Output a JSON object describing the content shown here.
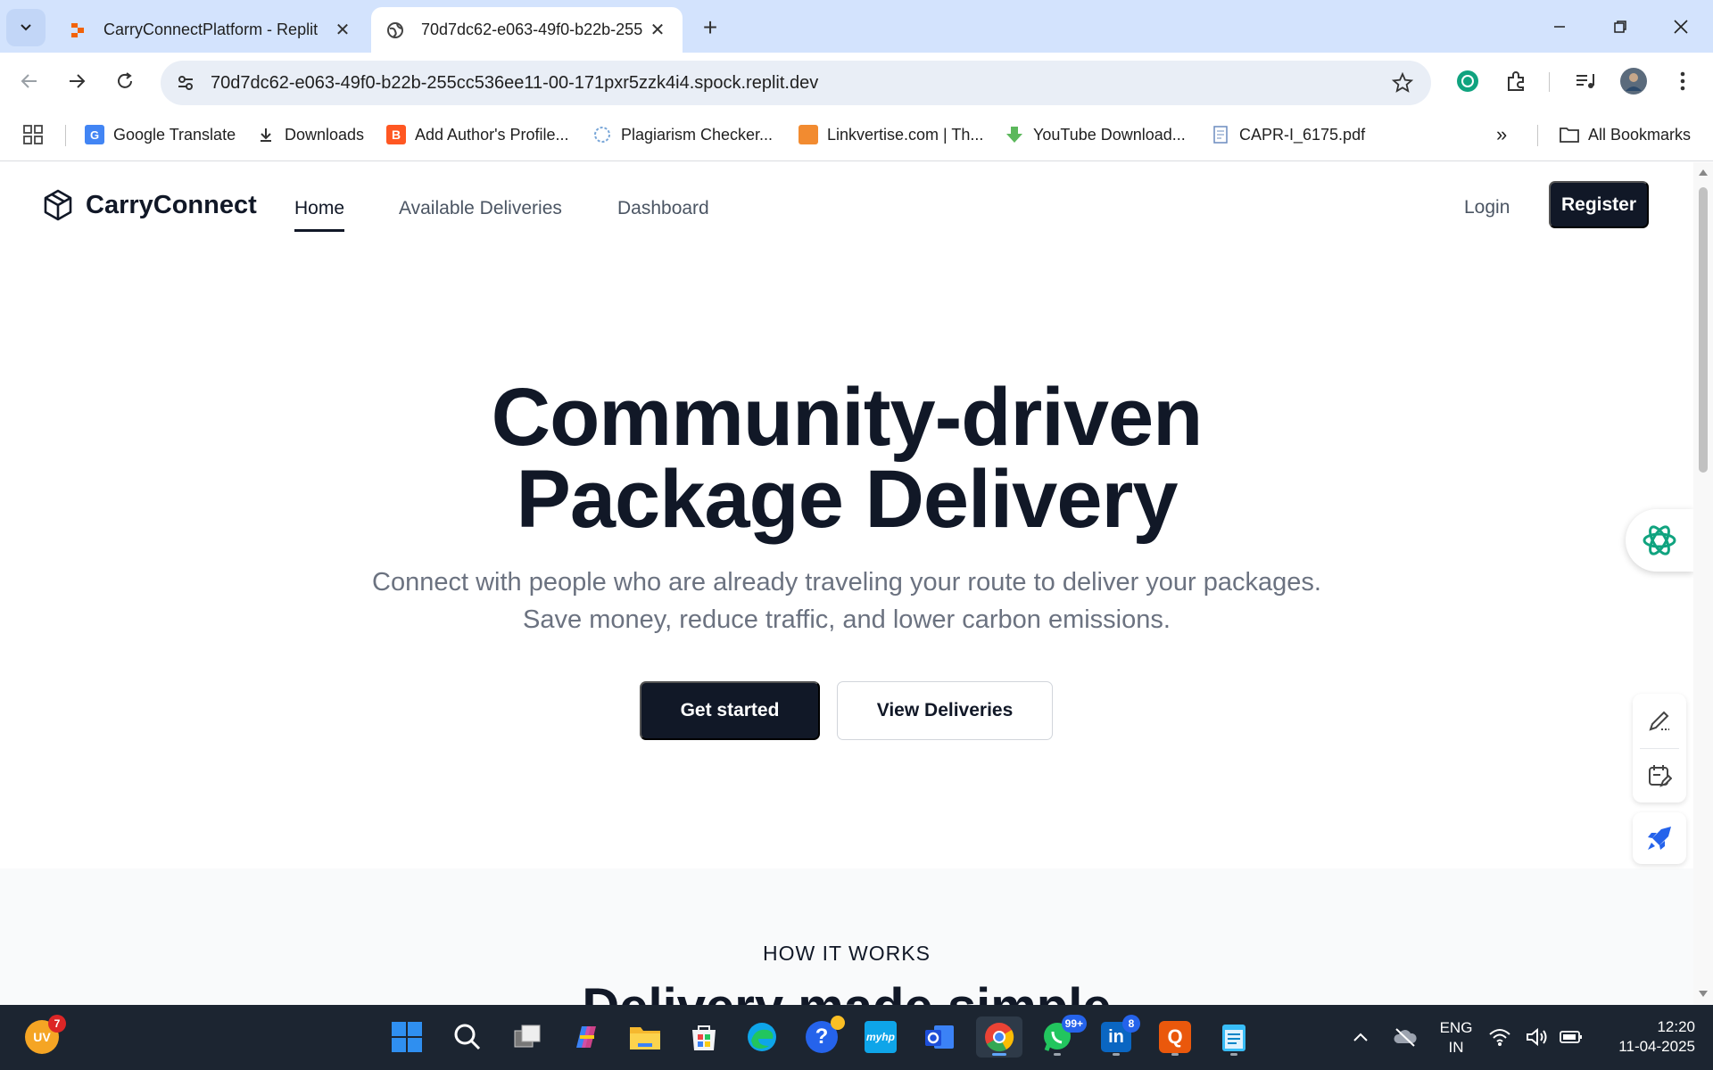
{
  "browser": {
    "tabs": [
      {
        "title": "CarryConnectPlatform - Replit",
        "active": false
      },
      {
        "title": "70d7dc62-e063-49f0-b22b-255",
        "active": true
      }
    ],
    "url": "70d7dc62-e063-49f0-b22b-255cc536ee11-00-171pxr5zzk4i4.spock.replit.dev",
    "bookmarks": [
      {
        "label": "Google Translate",
        "icon": "google-translate-icon"
      },
      {
        "label": "Downloads",
        "icon": "download-icon"
      },
      {
        "label": "Add Author's Profile...",
        "icon": "blogger-icon"
      },
      {
        "label": "Plagiarism Checker...",
        "icon": "plagiarism-icon"
      },
      {
        "label": "Linkvertise.com | Th...",
        "icon": "linkvertise-icon"
      },
      {
        "label": "YouTube Download...",
        "icon": "youtube-download-icon"
      },
      {
        "label": "CAPR-I_6175.pdf",
        "icon": "pdf-file-icon"
      }
    ],
    "all_bookmarks": "All Bookmarks"
  },
  "site": {
    "brand": "CarryConnect",
    "nav": [
      "Home",
      "Available Deliveries",
      "Dashboard"
    ],
    "login": "Login",
    "register": "Register"
  },
  "hero": {
    "title_line1": "Community-driven",
    "title_line2": "Package Delivery",
    "subtitle_line1": "Connect with people who are already traveling your route to deliver your packages.",
    "subtitle_line2": "Save money, reduce traffic, and lower carbon emissions.",
    "cta_primary": "Get started",
    "cta_secondary": "View Deliveries"
  },
  "how": {
    "kicker": "HOW IT WORKS",
    "title": "Delivery made simple"
  },
  "taskbar": {
    "user_initials": "UV",
    "user_badge": "7",
    "whatsapp_badge": "99+",
    "linkedin_badge": "8",
    "language_line1": "ENG",
    "language_line2": "IN",
    "time": "12:20",
    "date": "11-04-2025"
  },
  "colors": {
    "primary": "#111827",
    "muted_text": "#6b7280",
    "chrome_tabstrip": "#d3e3fd",
    "taskbar": "#1c2531"
  }
}
